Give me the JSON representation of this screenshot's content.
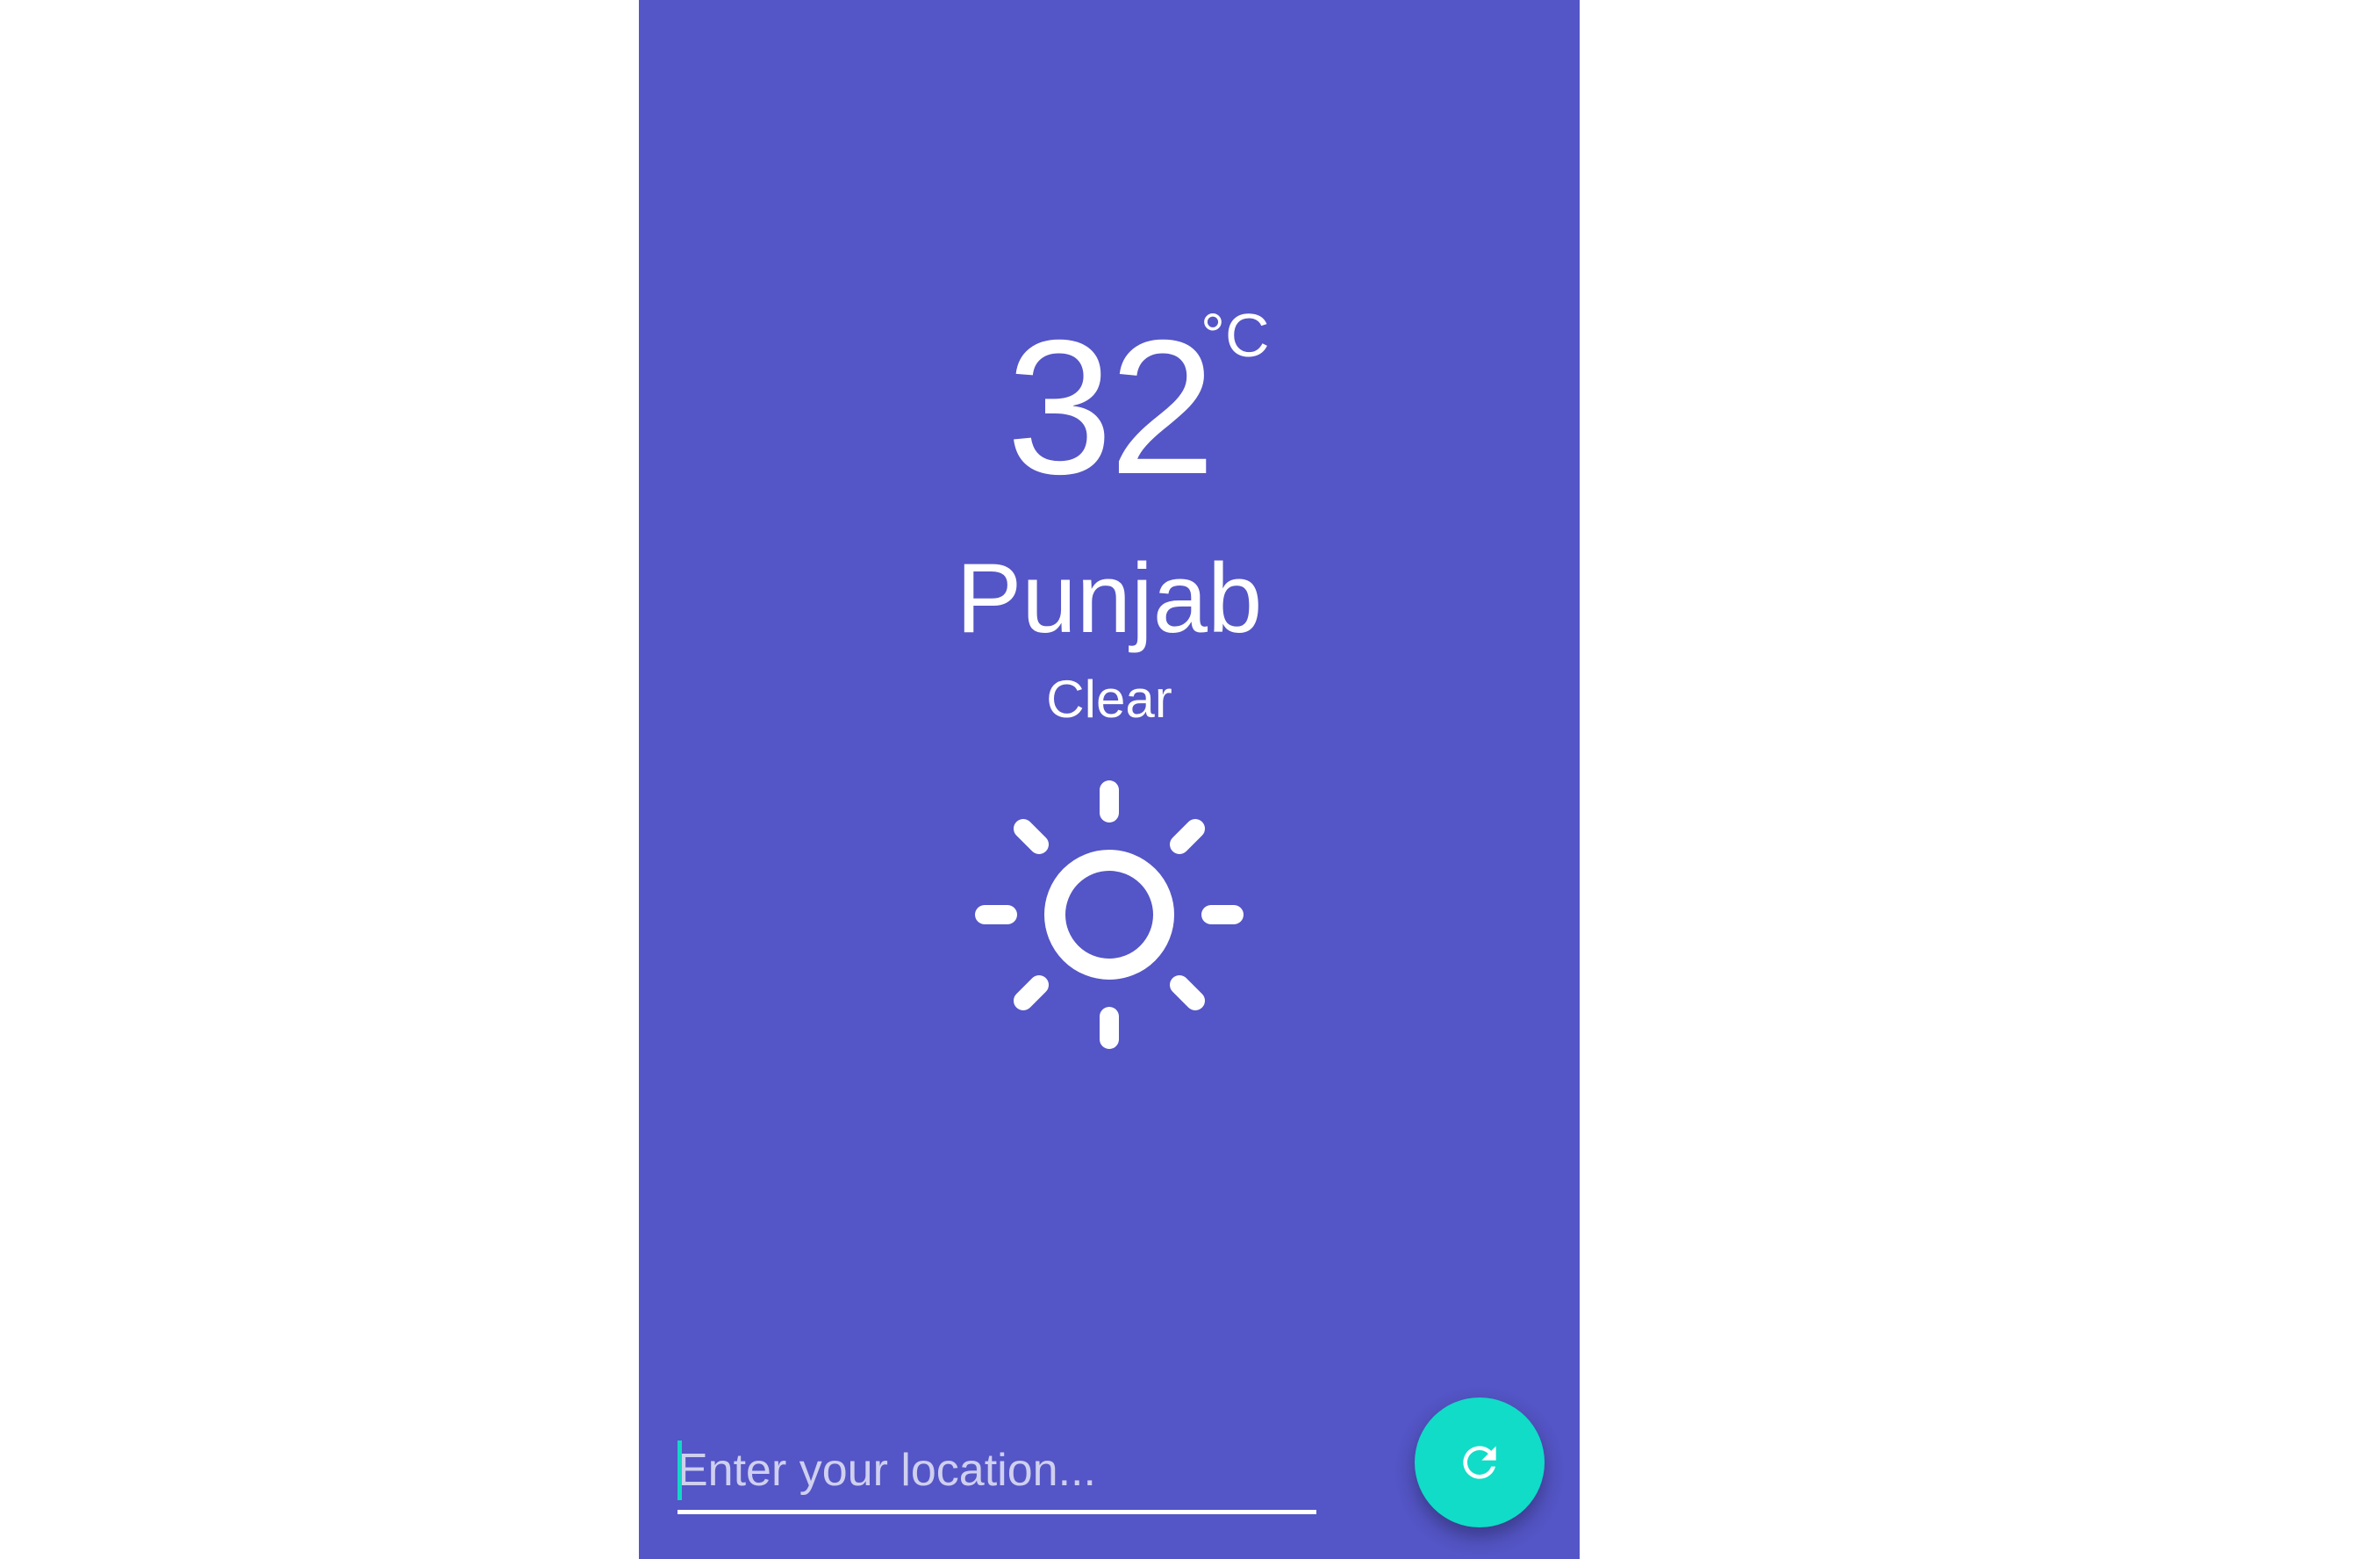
{
  "weather": {
    "temperature": "32",
    "unit": "°C",
    "location": "Punjab",
    "condition": "Clear",
    "icon": "sun-icon"
  },
  "search": {
    "placeholder": "Enter your location...",
    "value": ""
  },
  "refresh_button": {
    "icon": "refresh-icon"
  },
  "colors": {
    "background": "#5455c6",
    "accent": "#10dcc8",
    "text": "#ffffff"
  }
}
